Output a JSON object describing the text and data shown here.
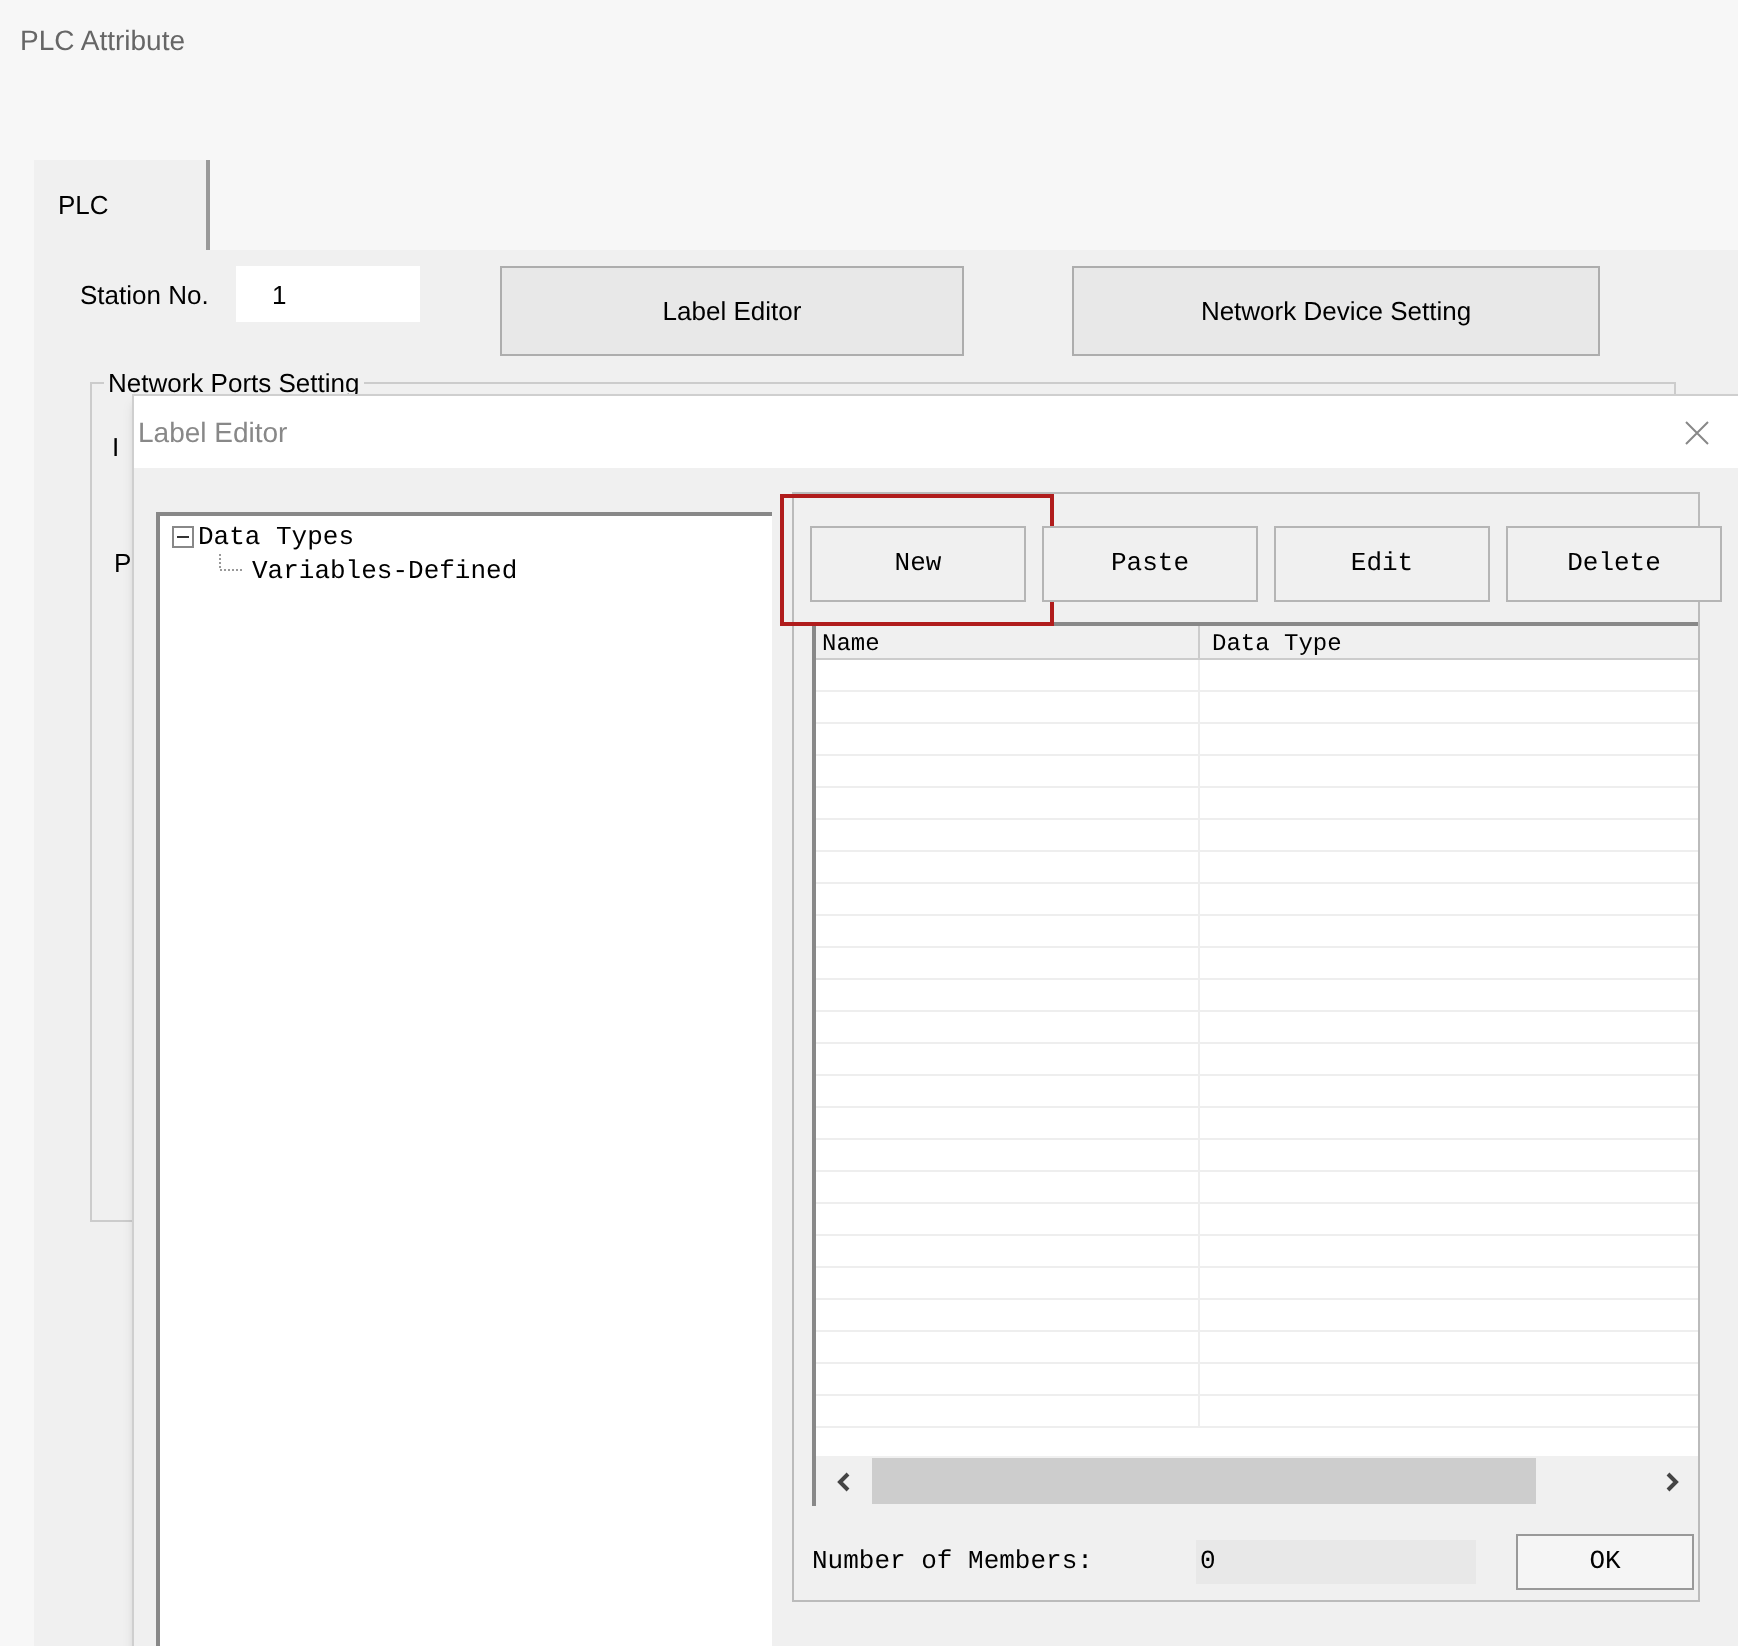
{
  "window": {
    "title": "PLC Attribute"
  },
  "tabs": [
    {
      "label": "PLC",
      "selected": true
    }
  ],
  "station": {
    "label": "Station No.",
    "value": "1"
  },
  "buttons": [
    "Label Editor",
    "Network Device Setting"
  ],
  "group": {
    "title": "Network Ports Setting",
    "labels": [
      "I",
      "P"
    ]
  },
  "dialog": {
    "title": "Label Editor",
    "tree": [
      {
        "label": "Data Types",
        "expanded": true,
        "children": [
          {
            "label": "Variables-Defined"
          }
        ]
      }
    ],
    "toolbar": [
      {
        "label": "New",
        "highlighted": true
      },
      {
        "label": "Paste",
        "highlighted": false
      },
      {
        "label": "Edit",
        "highlighted": false
      },
      {
        "label": "Delete",
        "highlighted": false
      }
    ],
    "table": {
      "columns": [
        "Name",
        "Data Type"
      ]
    },
    "members": {
      "label": "Number of Members:",
      "value": "0"
    },
    "ok": "OK"
  }
}
